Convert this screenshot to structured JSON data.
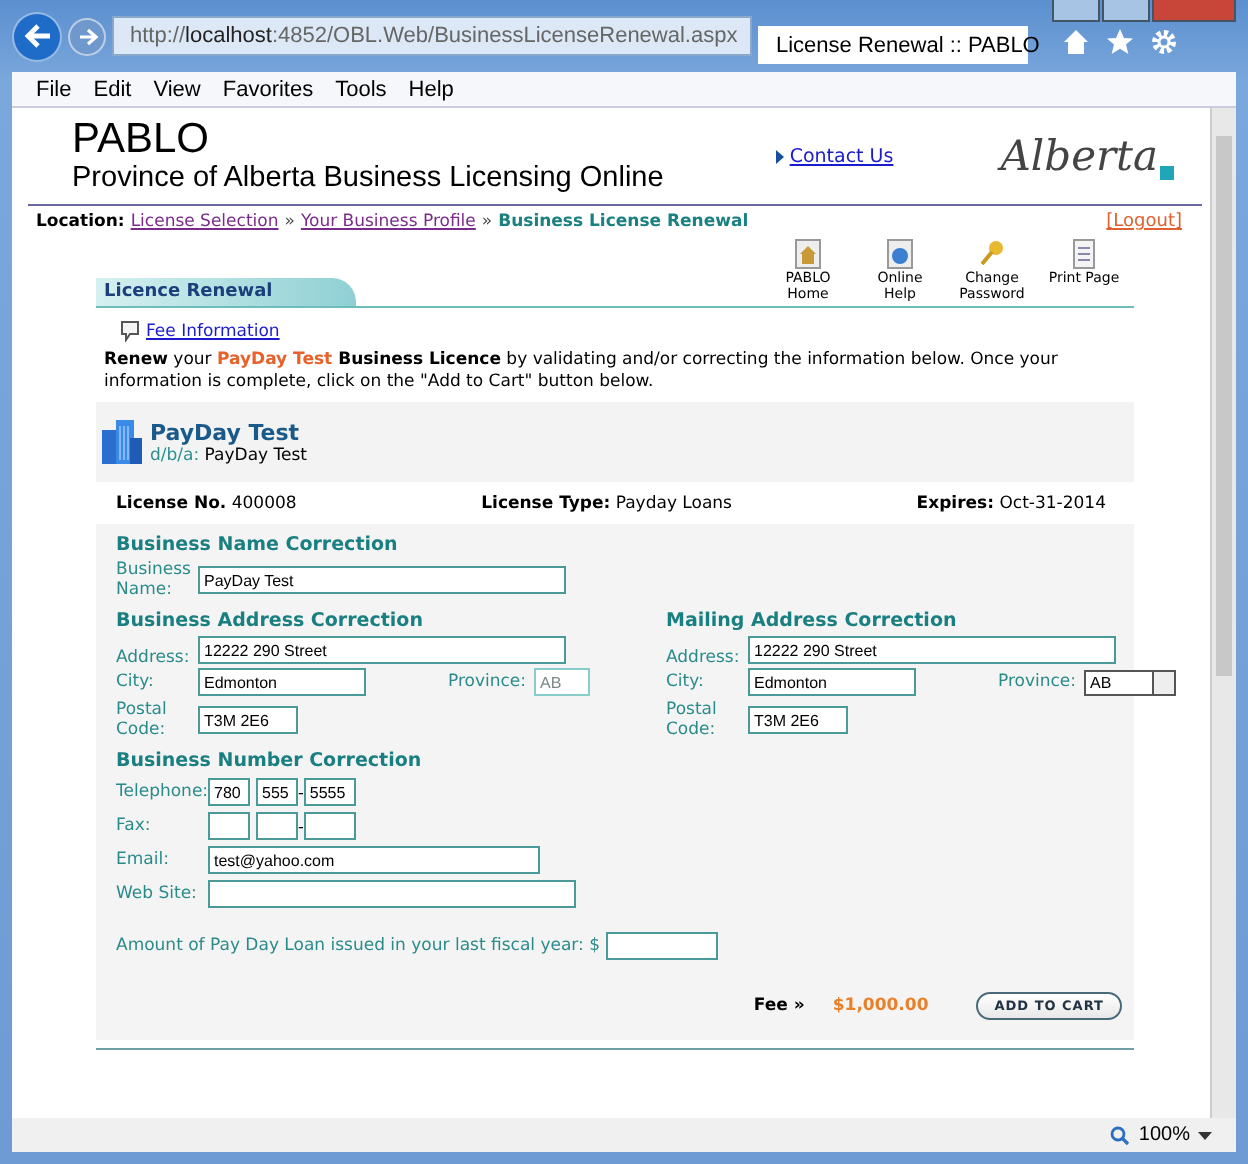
{
  "browser": {
    "url_scheme": "http://",
    "url_host": "localhost",
    "url_path": ":4852/OBL.Web/BusinessLicenseRenewal.aspx",
    "tab_title": "License Renewal :: PABLO",
    "zoom": "100%"
  },
  "menu": [
    "File",
    "Edit",
    "View",
    "Favorites",
    "Tools",
    "Help"
  ],
  "header": {
    "title": "PABLO",
    "subtitle": "Province of Alberta Business Licensing Online",
    "contact_link": "Contact Us",
    "logo": "Alberta"
  },
  "location": {
    "label": "Location:",
    "separator": "»",
    "logout": "[Logout]",
    "crumbs": [
      {
        "label": "License Selection",
        "kind": "link"
      },
      {
        "label": "Your Business Profile",
        "kind": "link"
      },
      {
        "label": "Business License Renewal",
        "kind": "current"
      }
    ]
  },
  "panel": {
    "title": "Licence Renewal",
    "tools": [
      {
        "label": "PABLO Home",
        "kind": "home"
      },
      {
        "label": "Online Help",
        "kind": "help"
      },
      {
        "label": "Change Password",
        "kind": "key"
      },
      {
        "label": "Print Page",
        "kind": "print"
      }
    ]
  },
  "fee_information": "Fee Information",
  "intro": [
    {
      "text": "Renew",
      "kind": "bold"
    },
    {
      "text": " your ",
      "kind": "plain"
    },
    {
      "text": "PayDay Test",
      "kind": "highlight"
    },
    {
      "text": " Business Licence",
      "kind": "bold"
    },
    {
      "text": " by validating and/or correcting the information below. Once your information is complete, click on the \"Add to Cart\" button below.",
      "kind": "plain"
    }
  ],
  "business": {
    "name": "PayDay Test",
    "dba_label": "d/b/a:",
    "dba": "PayDay Test"
  },
  "license_info": [
    {
      "label": "License No.",
      "value": "400008"
    },
    {
      "label": "License Type:",
      "value": "Payday Loans"
    },
    {
      "label": "Expires:",
      "value": "Oct-31-2014"
    }
  ],
  "business_name_section": {
    "heading": "Business Name Correction",
    "label": "Business Name:",
    "value": "PayDay Test"
  },
  "address_sections": [
    {
      "heading": "Business Address Correction",
      "address_label": "Address:",
      "address": "12222 290 Street",
      "city_label": "City:",
      "city": "Edmonton",
      "province_label": "Province:",
      "province": {
        "kind": "text",
        "value": "AB",
        "disabled": true
      },
      "postal_label": "Postal Code:",
      "postal": "T3M 2E6"
    },
    {
      "heading": "Mailing Address Correction",
      "address_label": "Address:",
      "address": "12222 290 Street",
      "city_label": "City:",
      "city": "Edmonton",
      "province_label": "Province:",
      "province": {
        "kind": "select",
        "value": "AB",
        "disabled": false
      },
      "postal_label": "Postal Code:",
      "postal": "T3M 2E6"
    }
  ],
  "number_section": {
    "heading": "Business Number Correction",
    "phone_separator": "-",
    "telephone_label": "Telephone:",
    "telephone": [
      "780",
      "555",
      "5555"
    ],
    "fax_label": "Fax:",
    "email_label": "Email:",
    "email": "test@yahoo.com",
    "website_label": "Web Site:",
    "amount_label": "Amount of Pay Day Loan issued in your last fiscal year: $"
  },
  "fee": {
    "label": "Fee »",
    "amount": "$1,000.00",
    "button": "ADD TO CART"
  }
}
